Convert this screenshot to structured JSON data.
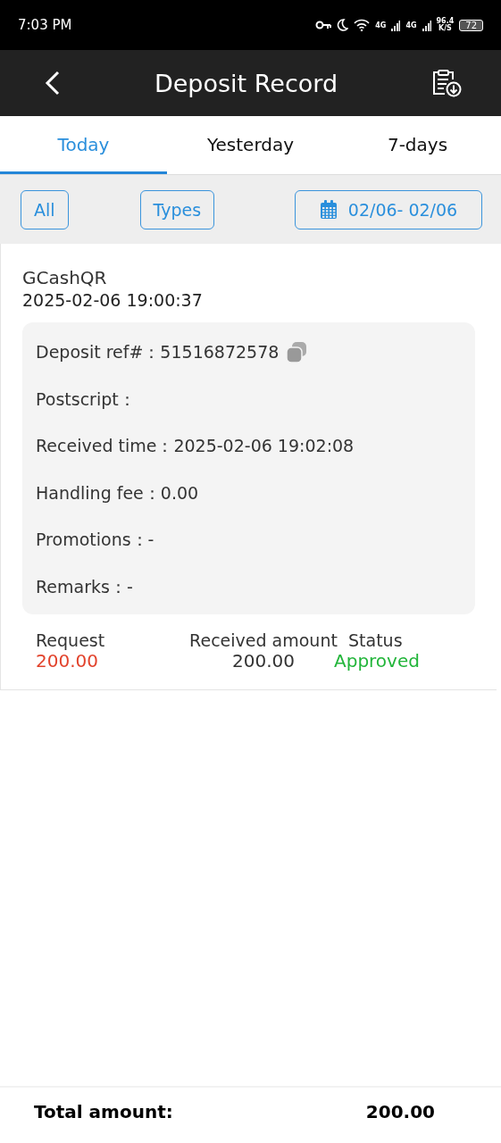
{
  "status_bar": {
    "time": "7:03 PM",
    "network_1": "4G",
    "network_2": "4G",
    "speed": "96.4",
    "speed_unit": "K/S",
    "battery": "72"
  },
  "header": {
    "title": "Deposit Record"
  },
  "tabs": [
    {
      "label": "Today",
      "selected": true
    },
    {
      "label": "Yesterday",
      "selected": false
    },
    {
      "label": "7-days",
      "selected": false
    }
  ],
  "filters": {
    "all": "All",
    "types": "Types",
    "date_range": "02/06- 02/06"
  },
  "records": [
    {
      "method": "GCashQR",
      "time": "2025-02-06 19:00:37",
      "details": [
        {
          "text": "Deposit ref#：51516872578",
          "copyable": true
        },
        {
          "text": "Postscript："
        },
        {
          "text": "Received time：2025-02-06 19:02:08"
        },
        {
          "text": "Handling fee：0.00"
        },
        {
          "text": "Promotions：-"
        },
        {
          "text": "Remarks：-"
        }
      ],
      "request_label": "Request",
      "request": "200.00",
      "received_label": "Received amount",
      "received": "200.00",
      "status_label": "Status",
      "status": "Approved"
    }
  ],
  "footer": {
    "label": "Total amount:",
    "value": "200.00"
  }
}
